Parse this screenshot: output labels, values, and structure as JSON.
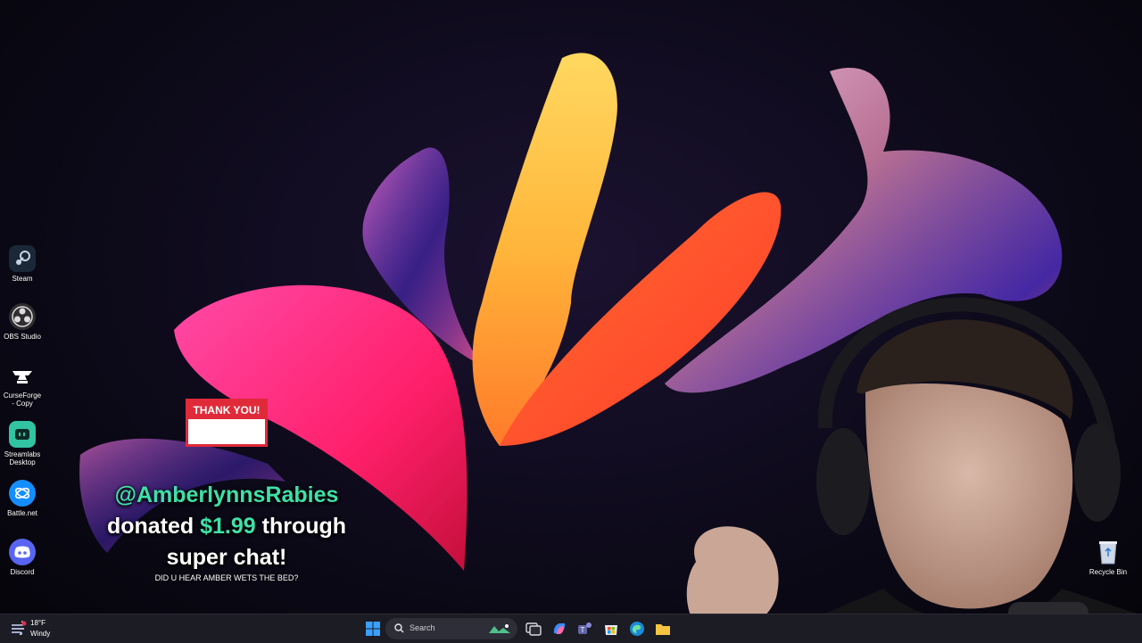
{
  "desktop": {
    "icons": [
      {
        "label": "Steam",
        "icon": "steam-icon"
      },
      {
        "label": "OBS Studio",
        "icon": "obs-icon"
      },
      {
        "label": "CurseForge - Copy",
        "icon": "curseforge-icon"
      },
      {
        "label": "Streamlabs Desktop",
        "icon": "streamlabs-icon"
      },
      {
        "label": "Battle.net",
        "icon": "battlenet-icon"
      },
      {
        "label": "Discord",
        "icon": "discord-icon"
      }
    ],
    "recycle_bin": {
      "label": "Recycle Bin",
      "icon": "recycle-bin-icon"
    }
  },
  "alert": {
    "card_title": "THANK YOU!",
    "username": "@AmberlynnsRabies",
    "word_donated": "donated",
    "amount": "$1.99",
    "word_through": "through",
    "line3": "super chat!",
    "message": "DID U HEAR AMBER WETS THE BED?"
  },
  "taskbar": {
    "weather_temp": "18°F",
    "weather_condition": "Windy",
    "search_placeholder": "Search",
    "pinned": [
      "start-icon",
      "search-icon",
      "task-view-icon",
      "copilot-icon",
      "teams-icon",
      "store-icon",
      "edge-icon",
      "file-explorer-icon"
    ]
  },
  "colors": {
    "alert_accent": "#40e0a8",
    "alert_card": "#e02a3a",
    "taskbar": "#1c1c24"
  }
}
